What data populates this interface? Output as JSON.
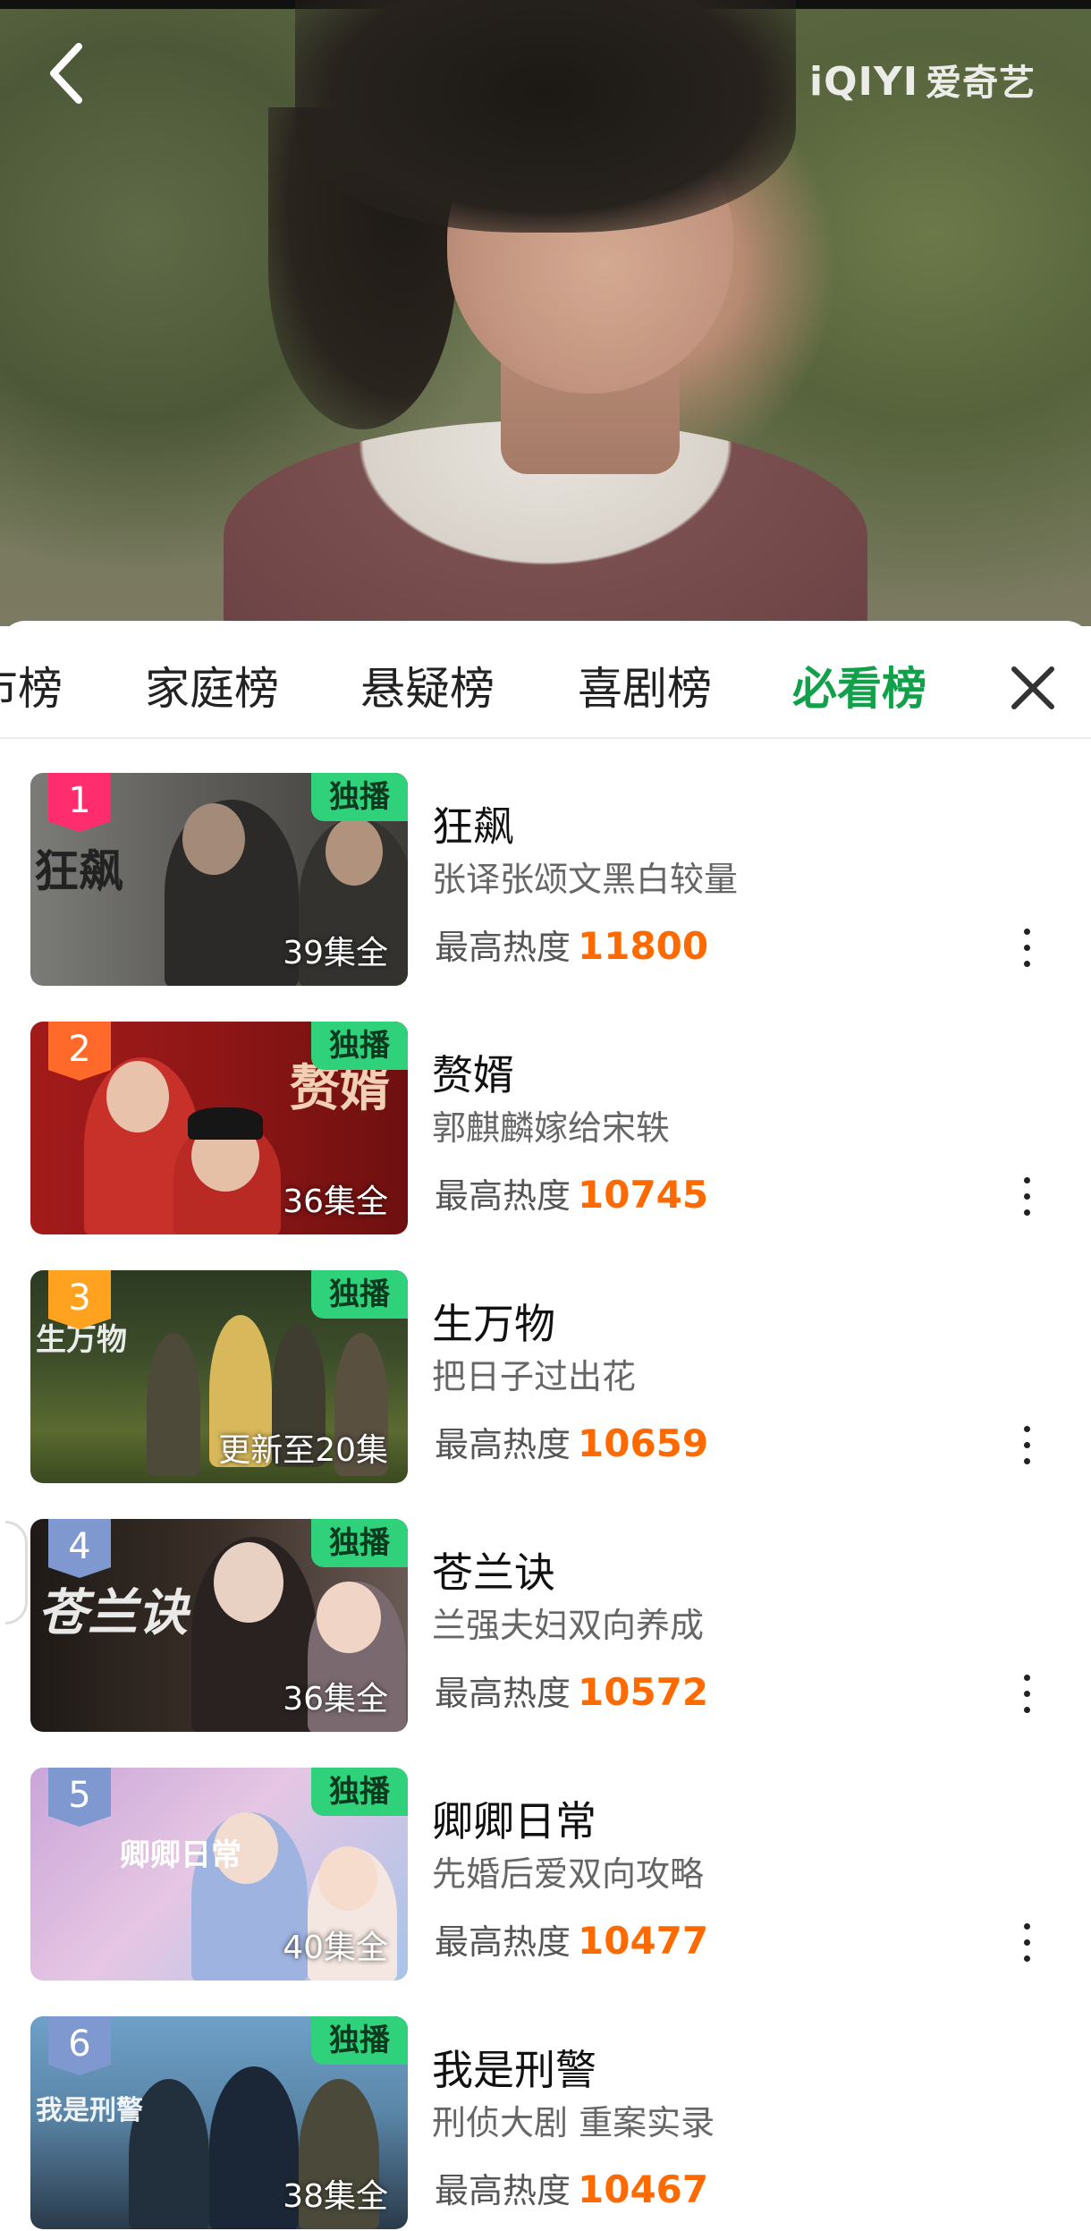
{
  "brand": {
    "logo_text": "iQIYI",
    "name": "爱奇艺"
  },
  "tabs": [
    {
      "label": "市榜"
    },
    {
      "label": "家庭榜"
    },
    {
      "label": "悬疑榜"
    },
    {
      "label": "喜剧榜"
    },
    {
      "label": "必看榜",
      "active": true
    }
  ],
  "heat_label": "最高热度",
  "exclusive_badge": "独播",
  "list": [
    {
      "rank": "1",
      "title": "狂飙",
      "desc": "张译张颂文黑白较量",
      "heat": "11800",
      "episodes": "39集全",
      "cover_title": "狂飙",
      "rank_color": "#ff2d6e"
    },
    {
      "rank": "2",
      "title": "赘婿",
      "desc": "郭麒麟嫁给宋轶",
      "heat": "10745",
      "episodes": "36集全",
      "cover_title": "赘婿",
      "rank_color": "#ff6a2b"
    },
    {
      "rank": "3",
      "title": "生万物",
      "desc": "把日子过出花",
      "heat": "10659",
      "episodes": "更新至20集",
      "cover_title": "生万物",
      "rank_color": "#ffa21f"
    },
    {
      "rank": "4",
      "title": "苍兰诀",
      "desc": "兰强夫妇双向养成",
      "heat": "10572",
      "episodes": "36集全",
      "cover_title": "苍兰诀",
      "rank_color": "#7f98cf"
    },
    {
      "rank": "5",
      "title": "卿卿日常",
      "desc": "先婚后爱双向攻略",
      "heat": "10477",
      "episodes": "40集全",
      "cover_title": "卿卿日常",
      "rank_color": "#7f98cf"
    },
    {
      "rank": "6",
      "title": "我是刑警",
      "desc": "刑侦大剧 重案实录",
      "heat": "10467",
      "episodes": "38集全",
      "cover_title": "我是刑警",
      "rank_color": "#7f98cf"
    }
  ]
}
